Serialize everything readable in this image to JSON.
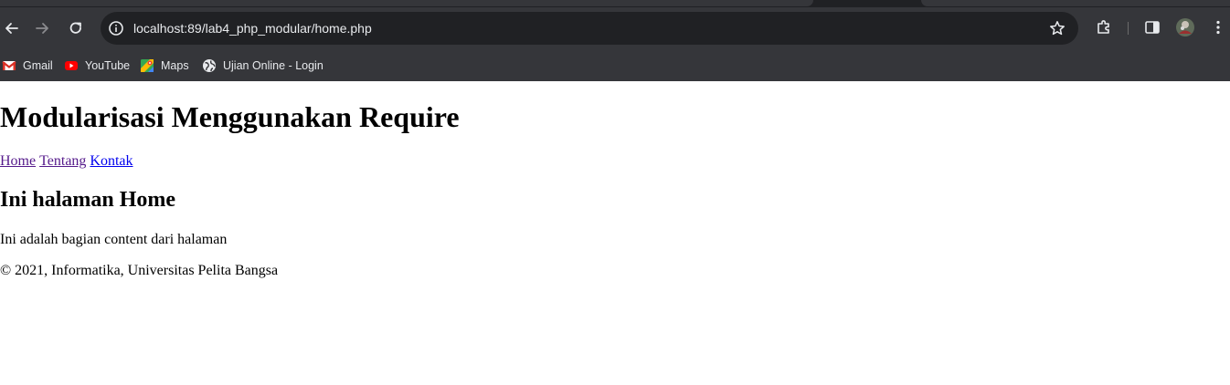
{
  "browser": {
    "url": "localhost:89/lab4_php_modular/home.php",
    "bookmarks": [
      {
        "label": "Gmail",
        "icon": "gmail-icon"
      },
      {
        "label": "YouTube",
        "icon": "youtube-icon"
      },
      {
        "label": "Maps",
        "icon": "maps-icon"
      },
      {
        "label": "Ujian Online - Login",
        "icon": "globe-icon"
      }
    ],
    "colors": {
      "chrome_bg": "#35363a",
      "omnibox_bg": "#202124",
      "text": "#e8eaed"
    }
  },
  "page": {
    "title": "Modularisasi Menggunakan Require",
    "nav": [
      {
        "label": "Home",
        "state": "visited"
      },
      {
        "label": "Tentang",
        "state": "visited"
      },
      {
        "label": "Kontak",
        "state": "link"
      }
    ],
    "heading": "Ini halaman Home",
    "content": "Ini adalah bagian content dari halaman",
    "footer": "© 2021, Informatika, Universitas Pelita Bangsa"
  }
}
